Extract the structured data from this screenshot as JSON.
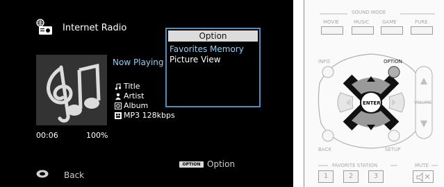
{
  "screen": {
    "source_name": "Internet Radio",
    "now_playing": "Now Playing",
    "meta": [
      {
        "icon": "music-note-icon",
        "text": "Title"
      },
      {
        "icon": "person-icon",
        "text": "Artist"
      },
      {
        "icon": "album-icon",
        "text": "Album"
      },
      {
        "icon": "format-icon",
        "text": "MP3 128kbps"
      }
    ],
    "elapsed": "00:06",
    "buffer": "100%",
    "back_label": "Back",
    "option_badge": "OPTION",
    "option_label": "Option"
  },
  "option_menu": {
    "title": "Option",
    "items": [
      "Favorites Memory",
      "Picture View"
    ]
  },
  "remote": {
    "sound_mode_label": "SOUND MODE",
    "mode_buttons": [
      "MOVIE",
      "MUSIC",
      "GAME",
      "PURE"
    ],
    "info": "INFO",
    "option": "OPTION",
    "enter": "ENTER",
    "volume": "VOLUME",
    "back": "BACK",
    "setup": "SETUP",
    "favorite_station": "FAVORITE STATION",
    "mute": "MUTE",
    "numbers": [
      "1",
      "2",
      "3"
    ]
  },
  "colors": {
    "accent_blue": "#8fd0f2",
    "panel_border": "#4f8fc0",
    "option_button_highlight": "#b0b0b0"
  }
}
